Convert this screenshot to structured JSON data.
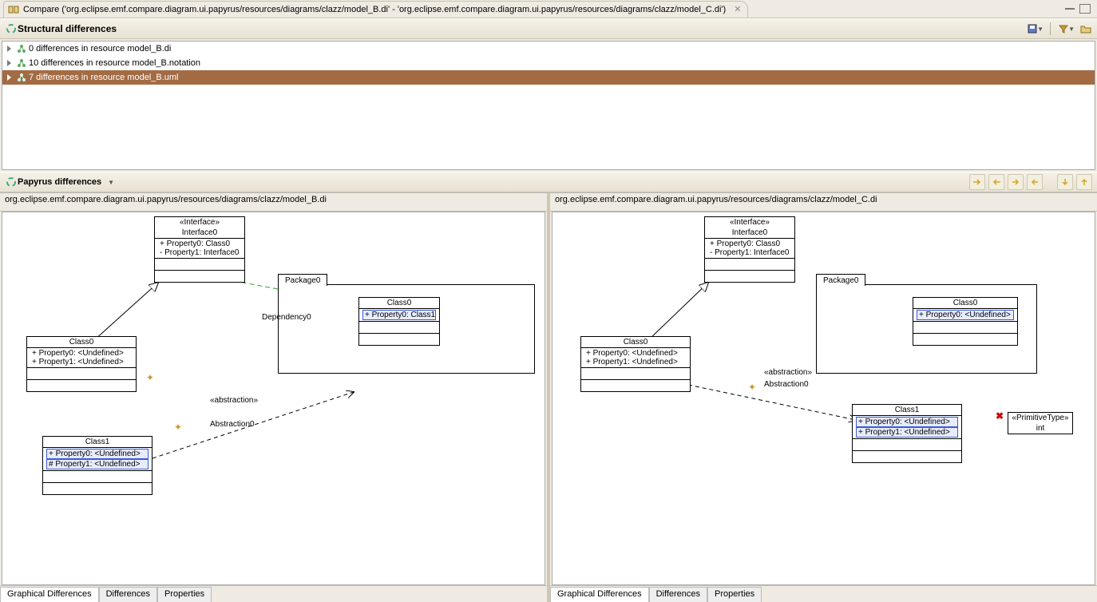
{
  "title_tab": "Compare ('org.eclipse.emf.compare.diagram.ui.papyrus/resources/diagrams/clazz/model_B.di' - 'org.eclipse.emf.compare.diagram.ui.papyrus/resources/diagrams/clazz/model_C.di')",
  "structural": {
    "header": "Structural differences",
    "rows": [
      {
        "label": "0 differences in resource model_B.di",
        "selected": false
      },
      {
        "label": "10 differences in resource model_B.notation",
        "selected": false
      },
      {
        "label": "7 differences in resource model_B.uml",
        "selected": true
      }
    ]
  },
  "papyrus": {
    "header": "Papyrus differences"
  },
  "left": {
    "path": "org.eclipse.emf.compare.diagram.ui.papyrus/resources/diagrams/clazz/model_B.di",
    "interface0": {
      "stereo": "«Interface»",
      "name": "Interface0",
      "p0": "+ Property0: Class0",
      "p1": "- Property1: Interface0"
    },
    "package0": {
      "name": "Package0"
    },
    "class0_in_pkg": {
      "name": "Class0",
      "p0": "+ Property0: Class1"
    },
    "class0": {
      "name": "Class0",
      "p0": "+ Property0: <Undefined>",
      "p1": "+ Property1: <Undefined>"
    },
    "class1": {
      "name": "Class1",
      "p0": "+ Property0: <Undefined>",
      "p1": "# Property1: <Undefined>"
    },
    "dependency_label": "Dependency0",
    "abstraction_stereo": "«abstraction»",
    "abstraction_label": "Abstraction0",
    "tabs": {
      "graphical": "Graphical Differences",
      "diff": "Differences",
      "props": "Properties"
    }
  },
  "right": {
    "path": "org.eclipse.emf.compare.diagram.ui.papyrus/resources/diagrams/clazz/model_C.di",
    "interface0": {
      "stereo": "«Interface»",
      "name": "Interface0",
      "p0": "+ Property0: Class0",
      "p1": "- Property1: Interface0"
    },
    "package0": {
      "name": "Package0"
    },
    "class0_in_pkg": {
      "name": "Class0",
      "p0": "+ Property0: <Undefined>"
    },
    "class0": {
      "name": "Class0",
      "p0": "+ Property0: <Undefined>",
      "p1": "+ Property1: <Undefined>"
    },
    "class1": {
      "name": "Class1",
      "p0": "+ Property0: <Undefined>",
      "p1": "+ Property1: <Undefined>"
    },
    "primtype": {
      "stereo": "«PrimitiveType»",
      "name": "int"
    },
    "abstraction_stereo": "«abstraction»",
    "abstraction_label": "Abstraction0",
    "tabs": {
      "graphical": "Graphical Differences",
      "diff": "Differences",
      "props": "Properties"
    }
  }
}
